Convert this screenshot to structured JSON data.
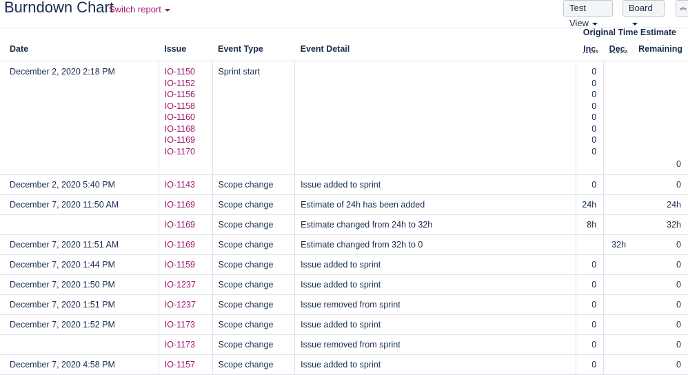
{
  "header": {
    "title": "Burndown Chart",
    "switch_report": "Switch report",
    "test_view": "Test View",
    "board": "Board",
    "collapse_icon": "double-chevron-up-icon"
  },
  "table": {
    "group_header": "Original Time Estimate",
    "columns": {
      "date": "Date",
      "issue": "Issue",
      "event_type": "Event Type",
      "event_detail": "Event Detail",
      "inc": "Inc.",
      "dec": "Dec.",
      "remaining": "Remaining"
    },
    "first_row": {
      "date": "December 2, 2020 2:18 PM",
      "event_type": "Sprint start",
      "event_detail": "",
      "issues": [
        "IO-1150",
        "IO-1152",
        "IO-1156",
        "IO-1158",
        "IO-1160",
        "IO-1168",
        "IO-1169",
        "IO-1170"
      ],
      "inc": [
        "0",
        "0",
        "0",
        "0",
        "0",
        "0",
        "0",
        "0"
      ],
      "dec": "",
      "remaining": "0"
    },
    "rows": [
      {
        "date": "December 2, 2020 5:40 PM",
        "issue": "IO-1143",
        "event_type": "Scope change",
        "event_detail": "Issue added to sprint",
        "inc": "0",
        "dec": "",
        "remaining": "0"
      },
      {
        "date": "December 7, 2020 11:50 AM",
        "issue": "IO-1169",
        "event_type": "Scope change",
        "event_detail": "Estimate of 24h has been added",
        "inc": "24h",
        "dec": "",
        "remaining": "24h"
      },
      {
        "date": "",
        "issue": "IO-1169",
        "event_type": "Scope change",
        "event_detail": "Estimate changed from 24h to 32h",
        "inc": "8h",
        "dec": "",
        "remaining": "32h"
      },
      {
        "date": "December 7, 2020 11:51 AM",
        "issue": "IO-1169",
        "event_type": "Scope change",
        "event_detail": "Estimate changed from 32h to 0",
        "inc": "",
        "dec": "32h",
        "remaining": "0"
      },
      {
        "date": "December 7, 2020 1:44 PM",
        "issue": "IO-1159",
        "event_type": "Scope change",
        "event_detail": "Issue added to sprint",
        "inc": "0",
        "dec": "",
        "remaining": "0"
      },
      {
        "date": "December 7, 2020 1:50 PM",
        "issue": "IO-1237",
        "event_type": "Scope change",
        "event_detail": "Issue added to sprint",
        "inc": "0",
        "dec": "",
        "remaining": "0"
      },
      {
        "date": "December 7, 2020 1:51 PM",
        "issue": "IO-1237",
        "event_type": "Scope change",
        "event_detail": "Issue removed from sprint",
        "inc": "0",
        "dec": "",
        "remaining": "0"
      },
      {
        "date": "December 7, 2020 1:52 PM",
        "issue": "IO-1173",
        "event_type": "Scope change",
        "event_detail": "Issue added to sprint",
        "inc": "0",
        "dec": "",
        "remaining": "0"
      },
      {
        "date": "",
        "issue": "IO-1173",
        "event_type": "Scope change",
        "event_detail": "Issue removed from sprint",
        "inc": "0",
        "dec": "",
        "remaining": "0"
      },
      {
        "date": "December 7, 2020 4:58 PM",
        "issue": "IO-1157",
        "event_type": "Scope change",
        "event_detail": "Issue added to sprint",
        "inc": "0",
        "dec": "",
        "remaining": "0"
      }
    ]
  }
}
